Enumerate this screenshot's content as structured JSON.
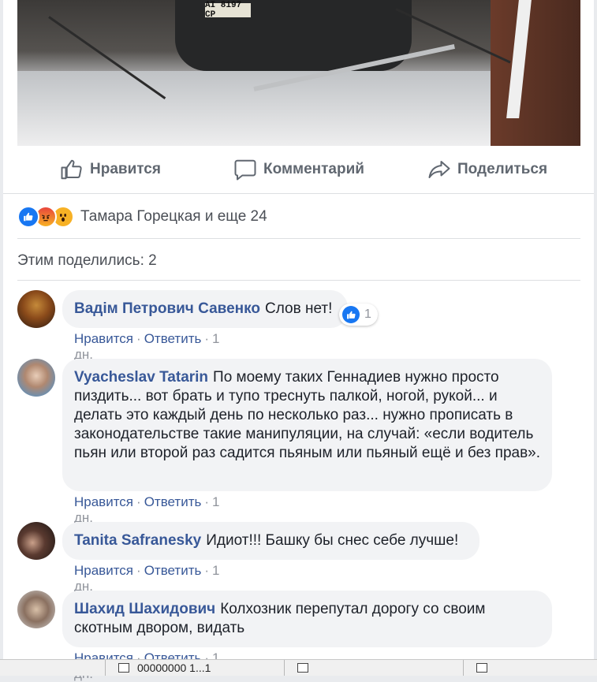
{
  "post": {
    "photo_plate": "AI 8197 CP"
  },
  "actions": {
    "like_label": "Нравится",
    "comment_label": "Комментарий",
    "share_label": "Поделиться"
  },
  "reactions": {
    "summary": "Тамара Горецкая и еще 24"
  },
  "shares": {
    "text": "Этим поделились: 2"
  },
  "comments": [
    {
      "author": "Вадім Петрович Савенко",
      "text": "Слов нет!",
      "like_label": "Нравится",
      "reply_label": "Ответить",
      "time": "1 дн.",
      "reaction_count": "1"
    },
    {
      "author": "Vyacheslav Tatarin",
      "text": "По моему таких Геннадиев нужно просто пиздить... вот брать и тупо треснуть палкой, ногой, рукой... и делать это каждый день по несколько раз... нужно прописать в законодательстве такие манипуляции, на случай: «если водитель пьян или второй раз садится пьяным или пьяный ещё и без прав».",
      "like_label": "Нравится",
      "reply_label": "Ответить",
      "time": "1 дн."
    },
    {
      "author": "Tanita Safranesky",
      "text": "Идиот!!! Башку бы снес себе лучше!",
      "like_label": "Нравится",
      "reply_label": "Ответить",
      "time": "1 дн."
    },
    {
      "author": "Шахид Шахидович",
      "text": "Колхозник перепутал дорогу со своим скотным двором, видать",
      "like_label": "Нравится",
      "reply_label": "Ответить",
      "time": "1 дн."
    }
  ],
  "taskbar": {
    "items": [
      "00000000 1...1",
      "",
      ""
    ]
  },
  "colors": {
    "link": "#385898",
    "like_blue": "#1877f2",
    "bubble_bg": "#f2f3f5"
  }
}
